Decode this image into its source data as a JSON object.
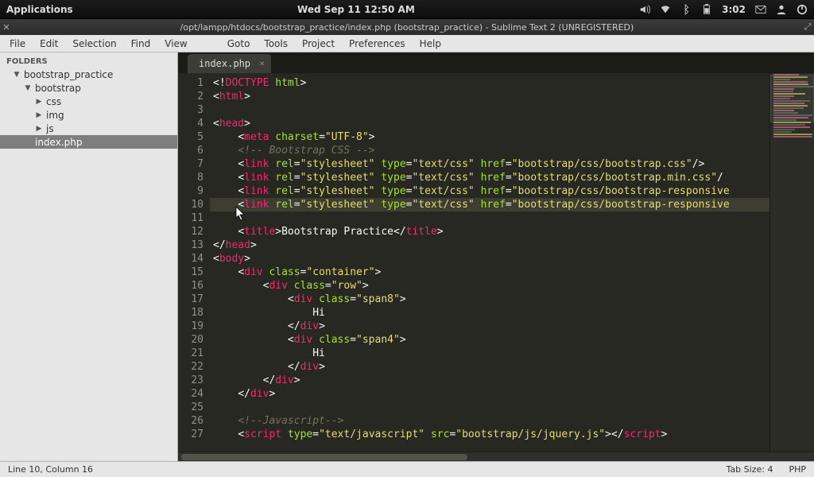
{
  "sysbar": {
    "apps": "Applications",
    "clock_center": "Wed Sep 11 12:50 AM",
    "clock_right": "3:02"
  },
  "window": {
    "title": "/opt/lampp/htdocs/bootstrap_practice/index.php (bootstrap_practice) - Sublime Text 2 (UNREGISTERED)"
  },
  "menu": {
    "file": "File",
    "edit": "Edit",
    "selection": "Selection",
    "find": "Find",
    "view": "View",
    "goto": "Goto",
    "tools": "Tools",
    "project": "Project",
    "preferences": "Preferences",
    "help": "Help"
  },
  "sidebar": {
    "hdr": "FOLDERS",
    "root": "bootstrap_practice",
    "bootstrap": "bootstrap",
    "css": "css",
    "img": "img",
    "js": "js",
    "index": "index.php"
  },
  "tab": {
    "name": "index.php"
  },
  "status": {
    "pos": "Line 10, Column 16",
    "tabsize": "Tab Size: 4",
    "lang": "PHP"
  },
  "code": {
    "lines": [
      {
        "n": "1",
        "html": "<span class='brkt'>&lt;!</span><span class='tag'>DOCTYPE</span> <span class='attr'>html</span><span class='brkt'>&gt;</span>"
      },
      {
        "n": "2",
        "html": "<span class='brkt'>&lt;</span><span class='tag'>html</span><span class='brkt'>&gt;</span>"
      },
      {
        "n": "3",
        "html": ""
      },
      {
        "n": "4",
        "html": "<span class='brkt'>&lt;</span><span class='tag'>head</span><span class='brkt'>&gt;</span>"
      },
      {
        "n": "5",
        "html": "    <span class='brkt'>&lt;</span><span class='tag'>meta</span> <span class='attr'>charset</span><span class='brkt'>=</span><span class='str'>\"UTF-8\"</span><span class='brkt'>&gt;</span>"
      },
      {
        "n": "6",
        "html": "    <span class='cmt'>&lt;!-- Bootstrap CSS --&gt;</span>"
      },
      {
        "n": "7",
        "html": "    <span class='brkt'>&lt;</span><span class='tag'>link</span> <span class='attr'>rel</span><span class='brkt'>=</span><span class='str'>\"stylesheet\"</span> <span class='attr'>type</span><span class='brkt'>=</span><span class='str'>\"text/css\"</span> <span class='attr'>href</span><span class='brkt'>=</span><span class='str'>\"bootstrap/css/bootstrap.css\"</span><span class='brkt'>/&gt;</span>"
      },
      {
        "n": "8",
        "html": "    <span class='brkt'>&lt;</span><span class='tag'>link</span> <span class='attr'>rel</span><span class='brkt'>=</span><span class='str'>\"stylesheet\"</span> <span class='attr'>type</span><span class='brkt'>=</span><span class='str'>\"text/css\"</span> <span class='attr'>href</span><span class='brkt'>=</span><span class='str'>\"bootstrap/css/bootstrap.min.css\"</span><span class='brkt'>/</span>"
      },
      {
        "n": "9",
        "html": "    <span class='brkt'>&lt;</span><span class='tag'>link</span> <span class='attr'>rel</span><span class='brkt'>=</span><span class='str'>\"stylesheet\"</span> <span class='attr'>type</span><span class='brkt'>=</span><span class='str'>\"text/css\"</span> <span class='attr'>href</span><span class='brkt'>=</span><span class='str'>\"bootstrap/css/bootstrap-responsive</span>"
      },
      {
        "n": "10",
        "html": "    <span class='brkt'>&lt;</span><span class='tag'>link</span> <span class='attr'>rel</span><span class='brkt'>=</span><span class='str'>\"stylesheet\"</span> <span class='attr'>type</span><span class='brkt'>=</span><span class='str'>\"text/css\"</span> <span class='attr'>href</span><span class='brkt'>=</span><span class='str'>\"bootstrap/css/bootstrap-responsive</span>",
        "hl": true
      },
      {
        "n": "11",
        "html": ""
      },
      {
        "n": "12",
        "html": "    <span class='brkt'>&lt;</span><span class='tag'>title</span><span class='brkt'>&gt;</span><span class='txt'>Bootstrap Practice</span><span class='brkt'>&lt;/</span><span class='tag'>title</span><span class='brkt'>&gt;</span>"
      },
      {
        "n": "13",
        "html": "<span class='brkt'>&lt;/</span><span class='tag'>head</span><span class='brkt'>&gt;</span>"
      },
      {
        "n": "14",
        "html": "<span class='brkt'>&lt;</span><span class='tag'>body</span><span class='brkt'>&gt;</span>"
      },
      {
        "n": "15",
        "html": "    <span class='brkt'>&lt;</span><span class='tag'>div</span> <span class='attr'>class</span><span class='brkt'>=</span><span class='str'>\"container\"</span><span class='brkt'>&gt;</span>"
      },
      {
        "n": "16",
        "html": "        <span class='brkt'>&lt;</span><span class='tag'>div</span> <span class='attr'>class</span><span class='brkt'>=</span><span class='str'>\"row\"</span><span class='brkt'>&gt;</span>"
      },
      {
        "n": "17",
        "html": "            <span class='brkt'>&lt;</span><span class='tag'>div</span> <span class='attr'>class</span><span class='brkt'>=</span><span class='str'>\"span8\"</span><span class='brkt'>&gt;</span>"
      },
      {
        "n": "18",
        "html": "                <span class='txt'>Hi</span>"
      },
      {
        "n": "19",
        "html": "            <span class='brkt'>&lt;/</span><span class='tag'>div</span><span class='brkt'>&gt;</span>"
      },
      {
        "n": "20",
        "html": "            <span class='brkt'>&lt;</span><span class='tag'>div</span> <span class='attr'>class</span><span class='brkt'>=</span><span class='str'>\"span4\"</span><span class='brkt'>&gt;</span>"
      },
      {
        "n": "21",
        "html": "                <span class='txt'>Hi</span>"
      },
      {
        "n": "22",
        "html": "            <span class='brkt'>&lt;/</span><span class='tag'>div</span><span class='brkt'>&gt;</span>"
      },
      {
        "n": "23",
        "html": "        <span class='brkt'>&lt;/</span><span class='tag'>div</span><span class='brkt'>&gt;</span>"
      },
      {
        "n": "24",
        "html": "    <span class='brkt'>&lt;/</span><span class='tag'>div</span><span class='brkt'>&gt;</span>"
      },
      {
        "n": "25",
        "html": ""
      },
      {
        "n": "26",
        "html": "    <span class='cmt'>&lt;!--Javascript--&gt;</span>"
      },
      {
        "n": "27",
        "html": "    <span class='brkt'>&lt;</span><span class='tag'>script</span> <span class='attr'>type</span><span class='brkt'>=</span><span class='str'>\"text/javascript\"</span> <span class='attr'>src</span><span class='brkt'>=</span><span class='str'>\"bootstrap/js/jquery.js\"</span><span class='brkt'>&gt;&lt;/</span><span class='tag'>script</span><span class='brkt'>&gt;</span>"
      }
    ]
  }
}
